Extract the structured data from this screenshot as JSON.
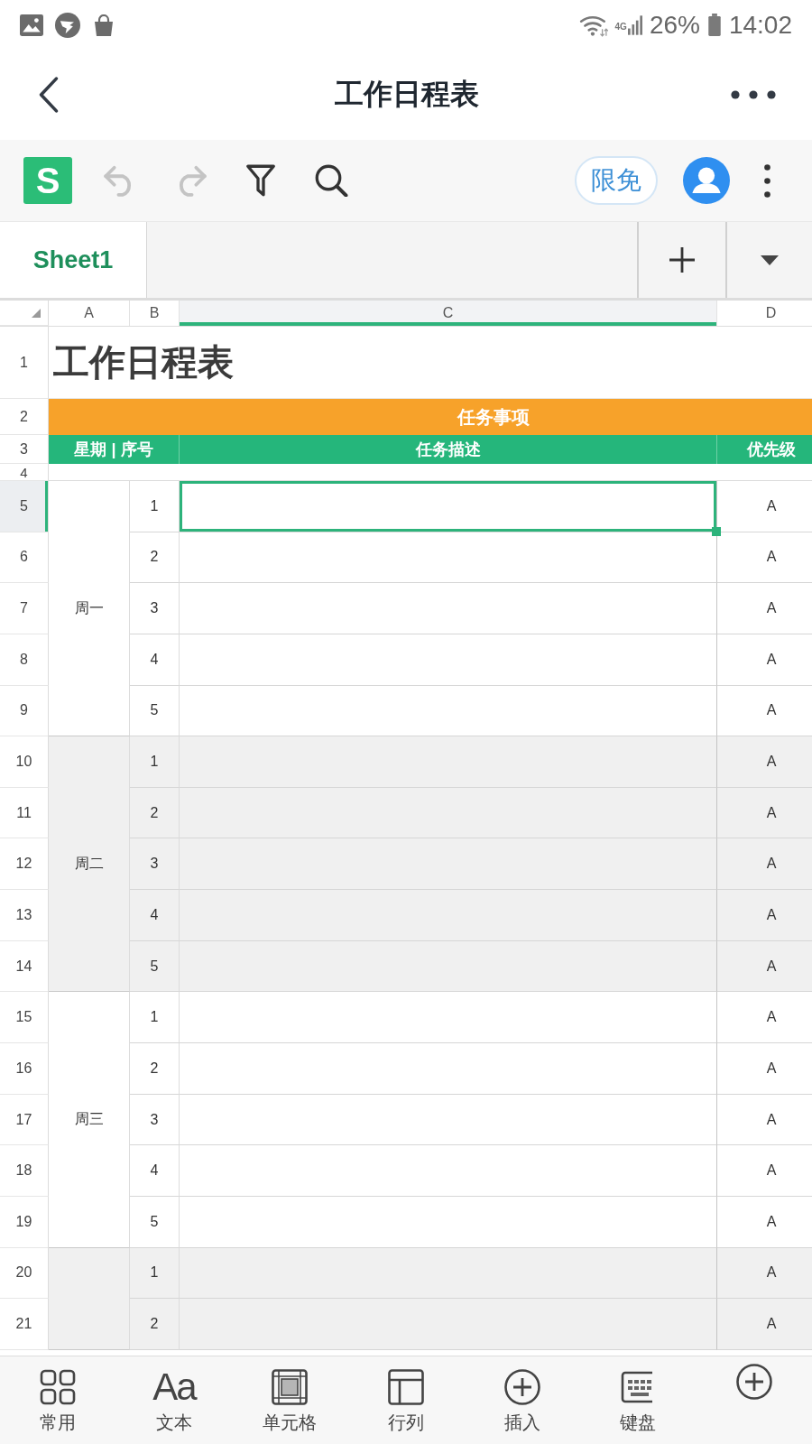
{
  "status_bar": {
    "network": "4G",
    "battery": "26%",
    "time": "14:02"
  },
  "title_bar": {
    "title": "工作日程表"
  },
  "toolbar": {
    "logo": "S",
    "tools": [
      {
        "kind": "undo",
        "disabled": true
      },
      {
        "kind": "redo",
        "disabled": true
      },
      {
        "kind": "filter",
        "disabled": false
      },
      {
        "kind": "search",
        "disabled": false
      }
    ],
    "badge": "限免"
  },
  "sheet_tabs": [
    {
      "label": "Sheet1",
      "selected": true
    }
  ],
  "grid": {
    "columns": [
      {
        "label": "A",
        "selected": false
      },
      {
        "label": "B",
        "selected": false
      },
      {
        "label": "C",
        "selected": true
      },
      {
        "label": "D",
        "selected": false
      }
    ],
    "title_row": {
      "row_number": "1",
      "text": "工作日程表"
    },
    "band_row": {
      "row_number": "2",
      "text": "任务事项"
    },
    "header_row": {
      "row_number": "3",
      "cells": [
        "星期 | 序号",
        "任务描述",
        "优先级"
      ]
    },
    "spacer_row": {
      "row_number": "4"
    },
    "groups": [
      {
        "day": "周一",
        "rows": [
          {
            "row_number": "5",
            "seq": "1",
            "priority": "A",
            "selected": true
          },
          {
            "row_number": "6",
            "seq": "2",
            "priority": "A",
            "selected": false
          },
          {
            "row_number": "7",
            "seq": "3",
            "priority": "A",
            "selected": false
          },
          {
            "row_number": "8",
            "seq": "4",
            "priority": "A",
            "selected": false
          },
          {
            "row_number": "9",
            "seq": "5",
            "priority": "A",
            "selected": false
          }
        ]
      },
      {
        "day": "周二",
        "rows": [
          {
            "row_number": "10",
            "seq": "1",
            "priority": "A",
            "selected": false
          },
          {
            "row_number": "11",
            "seq": "2",
            "priority": "A",
            "selected": false
          },
          {
            "row_number": "12",
            "seq": "3",
            "priority": "A",
            "selected": false
          },
          {
            "row_number": "13",
            "seq": "4",
            "priority": "A",
            "selected": false
          },
          {
            "row_number": "14",
            "seq": "5",
            "priority": "A",
            "selected": false
          }
        ]
      },
      {
        "day": "周三",
        "rows": [
          {
            "row_number": "15",
            "seq": "1",
            "priority": "A",
            "selected": false
          },
          {
            "row_number": "16",
            "seq": "2",
            "priority": "A",
            "selected": false
          },
          {
            "row_number": "17",
            "seq": "3",
            "priority": "A",
            "selected": false
          },
          {
            "row_number": "18",
            "seq": "4",
            "priority": "A",
            "selected": false
          },
          {
            "row_number": "19",
            "seq": "5",
            "priority": "A",
            "selected": false
          }
        ]
      },
      {
        "rows": [
          {
            "row_number": "20",
            "seq": "1",
            "priority": "A",
            "selected": false
          },
          {
            "row_number": "21",
            "seq": "2",
            "priority": "A",
            "selected": false
          }
        ]
      }
    ]
  },
  "bottom_bar": [
    {
      "kind": "common",
      "label": "常用"
    },
    {
      "kind": "text",
      "glyph": "Aa",
      "label": "文本"
    },
    {
      "kind": "cell",
      "label": "单元格"
    },
    {
      "kind": "rowcol",
      "label": "行列"
    },
    {
      "kind": "insert",
      "label": "插入"
    },
    {
      "kind": "keyboard",
      "label": "键盘"
    },
    {
      "kind": "add"
    }
  ]
}
